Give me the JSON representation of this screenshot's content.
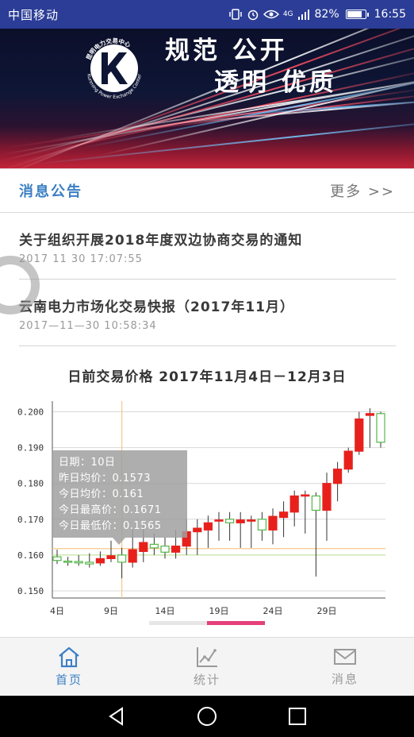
{
  "status_bar": {
    "carrier": "中国移动",
    "network": "4G",
    "battery": "82%",
    "battery_level": 0.82,
    "time": "16:55"
  },
  "banner": {
    "logo_text": "Kunming Power Exchange Center",
    "logo_text_cn": "昆明电力交易中心",
    "slogan_line1": "规范  公开",
    "slogan_line2": "透明  优质"
  },
  "notices": {
    "title": "消息公告",
    "more": "更多 >>",
    "items": [
      {
        "title": "关于组织开展2018年度双边协商交易的通知",
        "time": "2017 11 30 17:07:55"
      },
      {
        "title": "云南电力市场化交易快报（2017年11月）",
        "time": "2017—11—30 10:58:34"
      }
    ]
  },
  "chart_title": "日前交易价格 2017年11月4日－12月3日",
  "chart_data": {
    "type": "candlestick",
    "title": "日前交易价格 2017年11月4日－12月3日",
    "x_tick_labels": [
      "4日",
      "9日",
      "14日",
      "19日",
      "24日",
      "29日"
    ],
    "y_tick_labels": [
      "0.150",
      "0.160",
      "0.170",
      "0.180",
      "0.190",
      "0.200"
    ],
    "ylim": [
      0.148,
      0.203
    ],
    "candles": [
      {
        "day": 4,
        "open": 0.1595,
        "close": 0.1585,
        "high": 0.1615,
        "low": 0.1575
      },
      {
        "day": 5,
        "open": 0.1583,
        "close": 0.158,
        "high": 0.1595,
        "low": 0.157
      },
      {
        "day": 6,
        "open": 0.1582,
        "close": 0.1578,
        "high": 0.16,
        "low": 0.157
      },
      {
        "day": 7,
        "open": 0.158,
        "close": 0.1575,
        "high": 0.1605,
        "low": 0.1565
      },
      {
        "day": 8,
        "open": 0.1578,
        "close": 0.159,
        "high": 0.161,
        "low": 0.157
      },
      {
        "day": 9,
        "open": 0.159,
        "close": 0.1598,
        "high": 0.164,
        "low": 0.158
      },
      {
        "day": 10,
        "open": 0.16,
        "close": 0.158,
        "high": 0.162,
        "low": 0.1535
      },
      {
        "day": 11,
        "open": 0.158,
        "close": 0.1615,
        "high": 0.1671,
        "low": 0.1565
      },
      {
        "day": 12,
        "open": 0.161,
        "close": 0.1635,
        "high": 0.168,
        "low": 0.158
      },
      {
        "day": 13,
        "open": 0.163,
        "close": 0.162,
        "high": 0.166,
        "low": 0.16
      },
      {
        "day": 14,
        "open": 0.1625,
        "close": 0.1608,
        "high": 0.165,
        "low": 0.159
      },
      {
        "day": 15,
        "open": 0.1608,
        "close": 0.1625,
        "high": 0.167,
        "low": 0.159
      },
      {
        "day": 16,
        "open": 0.1625,
        "close": 0.1665,
        "high": 0.17,
        "low": 0.16
      },
      {
        "day": 17,
        "open": 0.1665,
        "close": 0.1675,
        "high": 0.17,
        "low": 0.16
      },
      {
        "day": 18,
        "open": 0.167,
        "close": 0.169,
        "high": 0.171,
        "low": 0.162
      },
      {
        "day": 19,
        "open": 0.1695,
        "close": 0.1698,
        "high": 0.172,
        "low": 0.164
      },
      {
        "day": 20,
        "open": 0.17,
        "close": 0.169,
        "high": 0.172,
        "low": 0.164
      },
      {
        "day": 21,
        "open": 0.169,
        "close": 0.1698,
        "high": 0.172,
        "low": 0.162
      },
      {
        "day": 22,
        "open": 0.1695,
        "close": 0.1698,
        "high": 0.171,
        "low": 0.162
      },
      {
        "day": 23,
        "open": 0.17,
        "close": 0.167,
        "high": 0.172,
        "low": 0.164
      },
      {
        "day": 24,
        "open": 0.167,
        "close": 0.1708,
        "high": 0.173,
        "low": 0.163
      },
      {
        "day": 25,
        "open": 0.1705,
        "close": 0.172,
        "high": 0.175,
        "low": 0.165
      },
      {
        "day": 26,
        "open": 0.172,
        "close": 0.1765,
        "high": 0.178,
        "low": 0.168
      },
      {
        "day": 27,
        "open": 0.1765,
        "close": 0.1768,
        "high": 0.178,
        "low": 0.166
      },
      {
        "day": 28,
        "open": 0.1765,
        "close": 0.1725,
        "high": 0.1775,
        "low": 0.154
      },
      {
        "day": 29,
        "open": 0.1725,
        "close": 0.18,
        "high": 0.183,
        "low": 0.164
      },
      {
        "day": 30,
        "open": 0.18,
        "close": 0.184,
        "high": 0.186,
        "low": 0.175
      },
      {
        "day": 31,
        "open": 0.184,
        "close": 0.189,
        "high": 0.19,
        "low": 0.183
      },
      {
        "day": 32,
        "open": 0.189,
        "close": 0.198,
        "high": 0.2,
        "low": 0.188
      },
      {
        "day": 33,
        "open": 0.199,
        "close": 0.1995,
        "high": 0.201,
        "low": 0.19
      },
      {
        "day": 34,
        "open": 0.1995,
        "close": 0.1915,
        "high": 0.2,
        "low": 0.19
      }
    ],
    "reference_lines": [
      {
        "value": 0.1618,
        "color": "#f5c98a"
      },
      {
        "value": 0.16,
        "color": "#c8e6a0"
      }
    ],
    "crosshair_day": 10,
    "up_color": "#e8201c",
    "down_color": "#55b84a",
    "grid": true
  },
  "tooltip": {
    "lines": [
      "日期：10日",
      "昨日均价：0.1573",
      "今日均价：0.161",
      "今日最高价：0.1671",
      "今日最低价：0.1565"
    ]
  },
  "scroll": {
    "position": 0.5
  },
  "tabs": [
    {
      "label": "首页",
      "icon": "home-icon",
      "active": true
    },
    {
      "label": "统计",
      "icon": "chart-icon",
      "active": false
    },
    {
      "label": "消息",
      "icon": "mail-icon",
      "active": false
    }
  ],
  "colors": {
    "status_bar": "#2b3d96",
    "accent": "#3b7fc4",
    "scroll_thumb": "#e4407a"
  }
}
